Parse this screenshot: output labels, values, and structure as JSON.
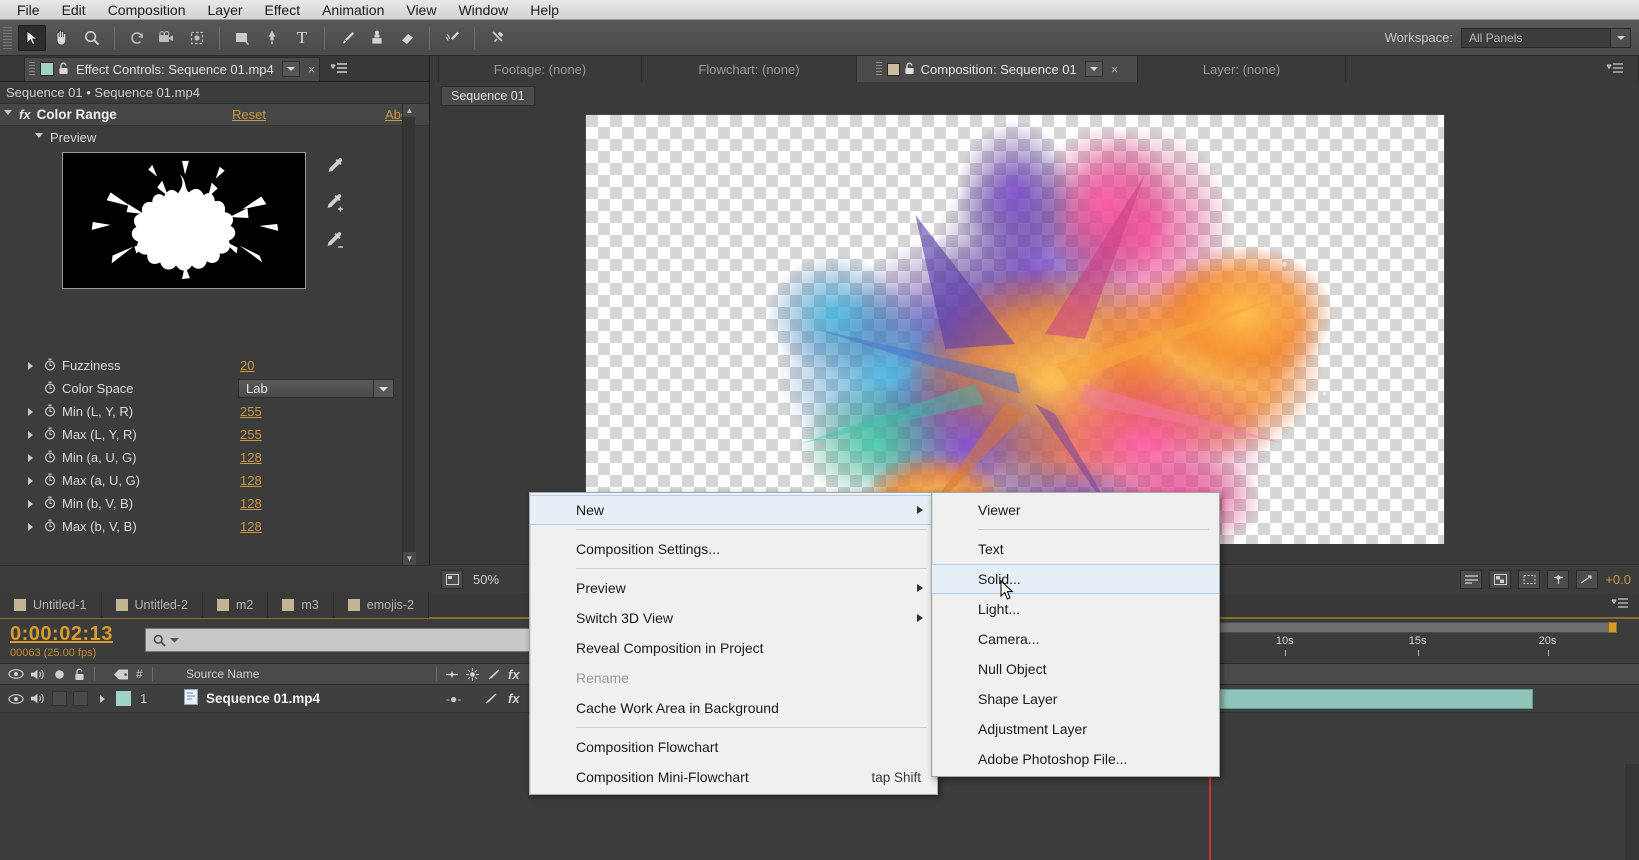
{
  "menubar": {
    "items": [
      "File",
      "Edit",
      "Composition",
      "Layer",
      "Effect",
      "Animation",
      "View",
      "Window",
      "Help"
    ]
  },
  "toolbar": {
    "workspace_label": "Workspace:",
    "workspace_value": "All Panels",
    "tools": [
      {
        "name": "selection-tool",
        "glyph": "➤"
      },
      {
        "name": "hand-tool",
        "glyph": "✋"
      },
      {
        "name": "zoom-tool",
        "glyph": "⚲"
      },
      {
        "name": "rotation-tool",
        "glyph": "↺"
      },
      {
        "name": "camera-tool",
        "glyph": "🎥"
      },
      {
        "name": "pan-behind-tool",
        "glyph": "⬚"
      },
      {
        "name": "shape-tool",
        "glyph": "■"
      },
      {
        "name": "pen-tool",
        "glyph": "✒"
      },
      {
        "name": "type-tool",
        "glyph": "T"
      },
      {
        "name": "brush-tool",
        "glyph": "╱"
      },
      {
        "name": "clone-stamp-tool",
        "glyph": "⚑"
      },
      {
        "name": "eraser-tool",
        "glyph": "▰"
      },
      {
        "name": "roto-brush-tool",
        "glyph": "✒"
      },
      {
        "name": "puppet-pin-tool",
        "glyph": "✕"
      }
    ]
  },
  "effect_controls": {
    "tab_title": "Effect Controls: Sequence 01.mp4",
    "breadcrumb": "Sequence 01 • Sequence 01.mp4",
    "effect_name": "Color Range",
    "fx_badge": "fx",
    "reset_label": "Reset",
    "about_label": "Abo",
    "preview_label": "Preview",
    "eyedroppers": [
      "eyedropper",
      "eyedropper-plus",
      "eyedropper-minus"
    ],
    "params": [
      {
        "name": "Fuzziness",
        "value": "20",
        "type": "number",
        "twirl": true
      },
      {
        "name": "Color Space",
        "value": "Lab",
        "type": "select",
        "twirl": false
      },
      {
        "name": "Min (L, Y, R)",
        "value": "255",
        "type": "number",
        "twirl": true
      },
      {
        "name": "Max (L, Y, R)",
        "value": "255",
        "type": "number",
        "twirl": true
      },
      {
        "name": "Min (a, U, G)",
        "value": "128",
        "type": "number",
        "twirl": true
      },
      {
        "name": "Max (a, U, G)",
        "value": "128",
        "type": "number",
        "twirl": true
      },
      {
        "name": "Min (b, V, B)",
        "value": "128",
        "type": "number",
        "twirl": true
      },
      {
        "name": "Max (b, V, B)",
        "value": "128",
        "type": "number",
        "twirl": true
      }
    ]
  },
  "viewer": {
    "tabs": [
      {
        "label": "Footage: (none)",
        "active": false
      },
      {
        "label": "Flowchart: (none)",
        "active": false
      },
      {
        "label": "Composition: Sequence 01",
        "active": true
      },
      {
        "label": "Layer: (none)",
        "active": false
      }
    ],
    "comp_chip": "Sequence 01",
    "zoom": "50%",
    "exposure": "+0.0"
  },
  "timeline": {
    "tabs": [
      {
        "label": "Untitled-1",
        "active": false
      },
      {
        "label": "Untitled-2",
        "active": false
      },
      {
        "label": "m2",
        "active": false
      },
      {
        "label": "m3",
        "active": false
      },
      {
        "label": "emojis-2",
        "active": false
      }
    ],
    "timecode": "0:00:02:13",
    "frame_info": "00063 (25.00 fps)",
    "search_placeholder": "",
    "column_headers": [
      "#",
      "Source Name"
    ],
    "layers": [
      {
        "index": "1",
        "name": "Sequence 01.mp4"
      }
    ],
    "ruler_ticks": [
      "10s",
      "15s",
      "20s"
    ]
  },
  "context_menu": {
    "items": [
      {
        "label": "New",
        "submenu": true,
        "selected": true,
        "disabled": false,
        "shortcut": "",
        "sep_after": true
      },
      {
        "label": "Composition Settings...",
        "submenu": false,
        "selected": false,
        "disabled": false,
        "shortcut": "",
        "sep_after": true
      },
      {
        "label": "Preview",
        "submenu": true,
        "selected": false,
        "disabled": false,
        "shortcut": "",
        "sep_after": false
      },
      {
        "label": "Switch 3D View",
        "submenu": true,
        "selected": false,
        "disabled": false,
        "shortcut": "",
        "sep_after": false
      },
      {
        "label": "Reveal Composition in Project",
        "submenu": false,
        "selected": false,
        "disabled": false,
        "shortcut": "",
        "sep_after": false
      },
      {
        "label": "Rename",
        "submenu": false,
        "selected": false,
        "disabled": true,
        "shortcut": "",
        "sep_after": false
      },
      {
        "label": "Cache Work Area in Background",
        "submenu": false,
        "selected": false,
        "disabled": false,
        "shortcut": "",
        "sep_after": true
      },
      {
        "label": "Composition Flowchart",
        "submenu": false,
        "selected": false,
        "disabled": false,
        "shortcut": "",
        "sep_after": false
      },
      {
        "label": "Composition Mini-Flowchart",
        "submenu": false,
        "selected": false,
        "disabled": false,
        "shortcut": "tap Shift",
        "sep_after": false
      }
    ]
  },
  "submenu": {
    "items": [
      {
        "label": "Viewer",
        "selected": false,
        "sep_after": true
      },
      {
        "label": "Text",
        "selected": false,
        "sep_after": false
      },
      {
        "label": "Solid...",
        "selected": true,
        "sep_after": false
      },
      {
        "label": "Light...",
        "selected": false,
        "sep_after": false
      },
      {
        "label": "Camera...",
        "selected": false,
        "sep_after": false
      },
      {
        "label": "Null Object",
        "selected": false,
        "sep_after": false
      },
      {
        "label": "Shape Layer",
        "selected": false,
        "sep_after": false
      },
      {
        "label": "Adjustment Layer",
        "selected": false,
        "sep_after": false
      },
      {
        "label": "Adobe Photoshop File...",
        "selected": false,
        "sep_after": false
      }
    ]
  },
  "colors": {
    "accent_orange": "#c79a42",
    "timecode_orange": "#d79a2b",
    "panel_bg": "#3c3c3c",
    "menu_bg": "#f0f0f0",
    "selection_blue": "#e6eff8",
    "layer_teal": "#8fc4bb"
  }
}
